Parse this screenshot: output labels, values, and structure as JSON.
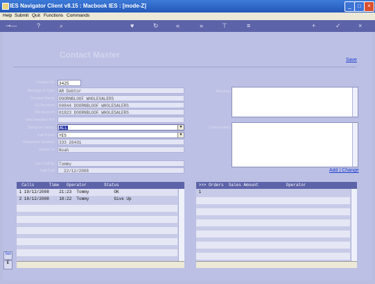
{
  "window": {
    "title": "IES Navigator Client v8.15 : Macbook IES :     [mode-Z]"
  },
  "menu": [
    "Help",
    "Submit",
    "Quit",
    "Functions",
    "Commands"
  ],
  "toolbar_icons": [
    "key-icon",
    "help-icon",
    "search-icon",
    "heart-icon",
    "refresh-icon",
    "rewind-icon",
    "fast-forward-icon",
    "tree-icon",
    "list-icon",
    "add-icon",
    "check-icon",
    "close-icon"
  ],
  "header": {
    "title": "Contact Master",
    "save_link": "Save"
  },
  "form": {
    "contact_no": {
      "label": "Contact No",
      "value": "3425"
    },
    "belongs_to_type": {
      "label": "Belongs to Type",
      "value": "AR Debtor"
    },
    "contact_name": {
      "label": "Contact Name",
      "value": "DOORNBLOOF WHOLESALERS"
    },
    "code_account": {
      "label": "GL/Account",
      "value": "00844 DOORNBLOOF WHOLESALERS"
    },
    "ar_account": {
      "label": "AR Account",
      "value": "01823 DOORNBLOOF WHOLESALERS"
    },
    "merchandise_ref": {
      "label": "Merchandise Ref",
      "value": ""
    },
    "selection_group": {
      "label": "Selection Group",
      "value": "ALL"
    },
    "call_direct": {
      "label": "Call Direct",
      "value": "YES"
    },
    "telephone_number": {
      "label": "Telephone Number",
      "value": "333 26431"
    },
    "speak_to": {
      "label": "Speak To",
      "value": "Noah"
    },
    "last_call_by": {
      "label": "Last Call By",
      "value": "Tommy"
    },
    "last_call": {
      "label": "Last Call",
      "value": "22/12/2008"
    },
    "attention": {
      "label": "Attention"
    },
    "commentary": {
      "label": "Commentary"
    }
  },
  "add_change_link": "Add | Change",
  "calls_table": {
    "header": "  Calls      Time   Operator       Status",
    "rows": [
      " 1 19/12/2008    21:23  Tommy          OK",
      " 2 18/12/2008    18:22  Tommy          Give Up"
    ]
  },
  "orders_table": {
    "header": " >>> Orders  Sales Amount           Operator",
    "rows": [
      " 1"
    ]
  },
  "side_labels": [
    "Sel",
    "E"
  ]
}
